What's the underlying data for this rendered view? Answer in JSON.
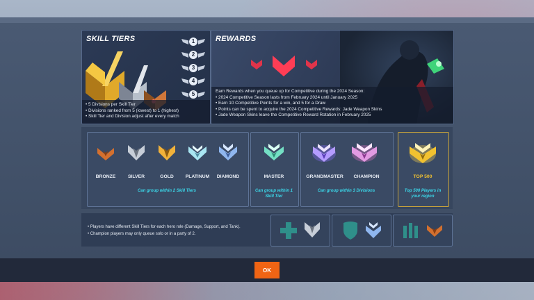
{
  "skill_tiers": {
    "title": "SKILL TIERS",
    "divisions": [
      "1",
      "2",
      "3",
      "4",
      "5"
    ],
    "notes": [
      "• 5 Divisions per Skill Tier",
      "• Divisions ranked from 5 (lowest) to 1 (highest)",
      "• Skill Tier and Division adjust after every match"
    ]
  },
  "rewards": {
    "title": "REWARDS",
    "notes": [
      "Earn Rewards when you queue up for Competitive during the 2024 Season:",
      "• 2024 Competitive Season lasts from February 2024 until January 2025",
      "• Earn 10 Competitive Points for a win, and 5 for a Draw",
      "• Points can be spent to acquire the 2024 Competitive Rewards: Jade Weapon Skins",
      "• Jade Weapon Skins leave the Competitive Reward Rotation in February 2025"
    ]
  },
  "tiers": {
    "bronze": "BRONZE",
    "silver": "SILVER",
    "gold": "GOLD",
    "platinum": "PLATINUM",
    "diamond": "DIAMOND",
    "master": "MASTER",
    "grandmaster": "GRANDMASTER",
    "champion": "CHAMPION",
    "top500": "TOP 500"
  },
  "group_notes": {
    "low": "Can group within 2 Skill Tiers",
    "master": "Can group within 1 Skill Tier",
    "high": "Can group within 3 Divisions",
    "top500": "Top 500 Players in your region"
  },
  "info": {
    "notes": [
      "• Players have different Skill Tiers for each hero role (Damage, Support, and Tank).",
      "• Champion players may only queue solo or in a party of 2."
    ]
  },
  "roles": [
    "support-icon",
    "tank-icon",
    "damage-icon"
  ],
  "footer": {
    "ok_label": "OK"
  },
  "colors": {
    "accent_cyan": "#3bd6e8",
    "ok_orange": "#f06414",
    "top500_gold": "#f2c230"
  }
}
